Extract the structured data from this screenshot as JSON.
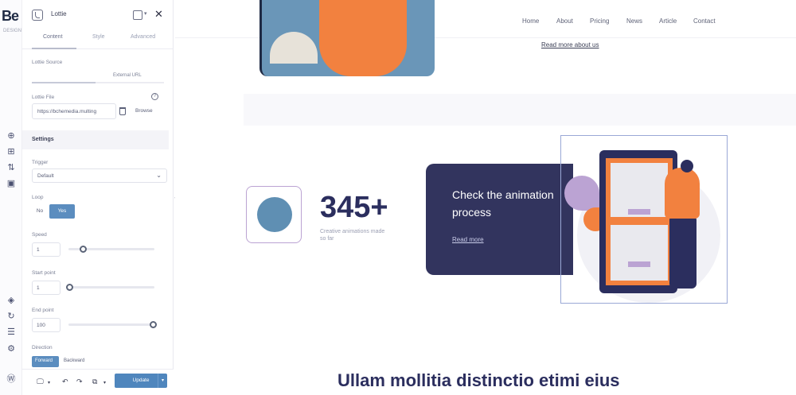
{
  "rail": {
    "logo": "Be",
    "logo_sub": "DESIGN",
    "icons": [
      "add-icon",
      "layout-icon",
      "sort-icon",
      "page-icon",
      "layers-icon",
      "history-icon",
      "sliders-icon",
      "settings-icon",
      "wordpress-icon"
    ]
  },
  "panel": {
    "title": "Lottie",
    "tabs": [
      "Content",
      "Style",
      "Advanced"
    ],
    "lottie_source_label": "Lottie Source",
    "external_url": "External URL",
    "lottie_file_label": "Lottie File",
    "lottie_file_value": "https://bchemedia.multing",
    "browse": "Browse",
    "settings_header": "Settings",
    "trigger_label": "Trigger",
    "trigger_value": "Default",
    "loop_label": "Loop",
    "loop_no": "No",
    "loop_yes": "Yes",
    "speed_label": "Speed",
    "speed_value": "1",
    "start_label": "Start point",
    "start_value": "1",
    "end_label": "End point",
    "end_value": "100",
    "direction_label": "Direction",
    "direction_forward": "Forward",
    "direction_backward": "Backward",
    "update_button": "Update"
  },
  "nav": {
    "items": [
      "Home",
      "About",
      "Pricing",
      "News",
      "Article",
      "Contact"
    ]
  },
  "content": {
    "read_more_about": "Read more about us",
    "stat_value": "345+",
    "stat_caption": "Creative animations made so far",
    "cta_title": "Check the animation process",
    "cta_link": "Read more",
    "heading": "Ullam mollitia distinctio etimi eius"
  },
  "colors": {
    "accent_blue": "#5b8dbf",
    "navy": "#32345e",
    "orange": "#f2813f",
    "lilac": "#bba3d3"
  }
}
